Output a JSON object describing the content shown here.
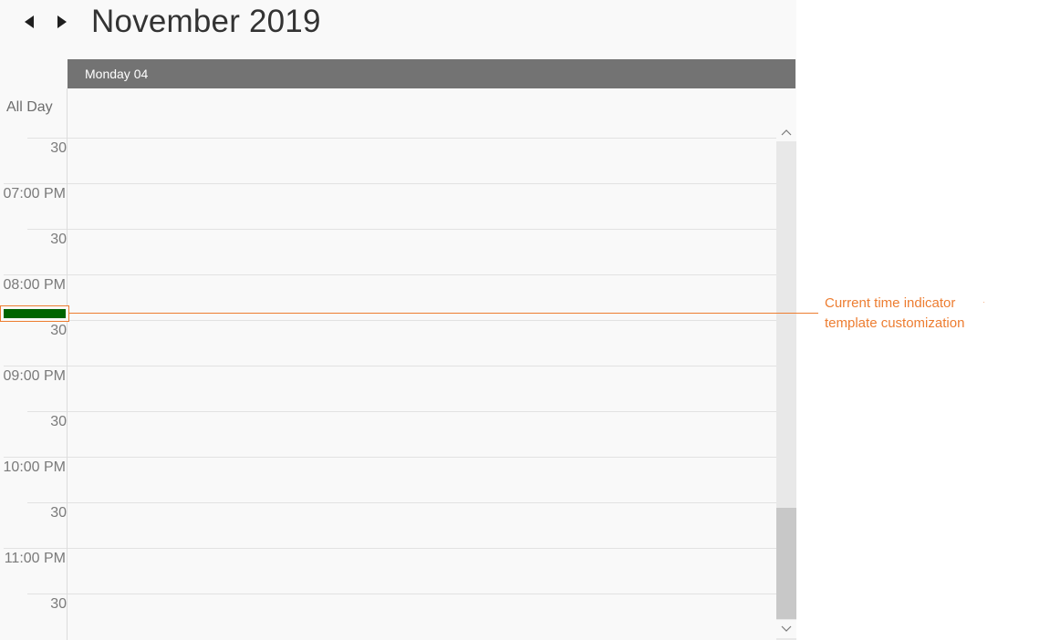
{
  "header": {
    "title": "November 2019",
    "prev_icon": "triangle-left-icon",
    "next_icon": "triangle-right-icon"
  },
  "day_header": {
    "label": "Monday 04"
  },
  "all_day": {
    "label": "All Day"
  },
  "time_slots": [
    {
      "label": "30",
      "kind": "half"
    },
    {
      "label": "07:00 PM",
      "kind": "hour"
    },
    {
      "label": "30",
      "kind": "half"
    },
    {
      "label": "08:00 PM",
      "kind": "hour"
    },
    {
      "label": "30",
      "kind": "half"
    },
    {
      "label": "09:00 PM",
      "kind": "hour"
    },
    {
      "label": "30",
      "kind": "half"
    },
    {
      "label": "10:00 PM",
      "kind": "hour"
    },
    {
      "label": "30",
      "kind": "half"
    },
    {
      "label": "11:00 PM",
      "kind": "hour"
    },
    {
      "label": "30",
      "kind": "half"
    }
  ],
  "scrollbar": {
    "up_icon": "chevron-up-icon",
    "down_icon": "chevron-down-icon"
  },
  "current_time_indicator": {
    "marker_color": "#006400",
    "line_color": "#ed7d31"
  },
  "annotation": {
    "line1": "Current time indicator",
    "line2": "template customization",
    "color": "#ed7d31"
  }
}
